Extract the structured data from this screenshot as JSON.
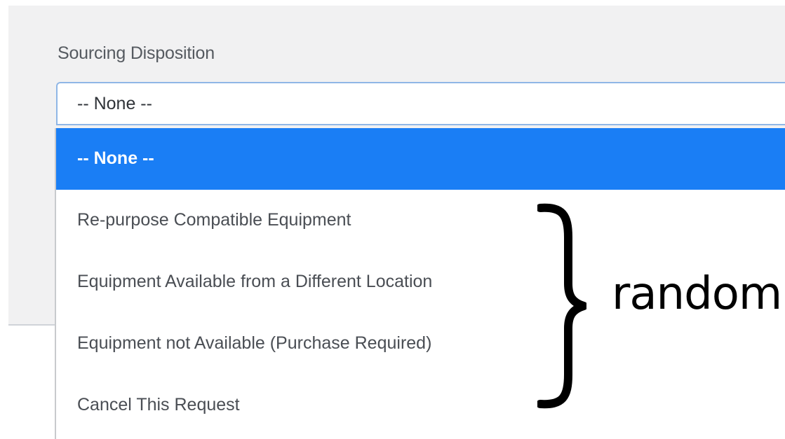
{
  "field": {
    "label": "Sourcing Disposition",
    "value": "-- None --"
  },
  "dropdown": {
    "options": [
      {
        "label": "-- None --",
        "selected": true
      },
      {
        "label": "Re-purpose Compatible Equipment",
        "selected": false
      },
      {
        "label": "Equipment Available from a Different Location",
        "selected": false
      },
      {
        "label": "Equipment not Available (Purchase Required)",
        "selected": false
      },
      {
        "label": "Cancel This Request",
        "selected": false
      }
    ]
  },
  "annotation": {
    "text": "random"
  },
  "colors": {
    "selected_bg": "#1a7ef5",
    "panel_bg": "#f1f1f2",
    "focus_border": "#8fb6e6"
  }
}
